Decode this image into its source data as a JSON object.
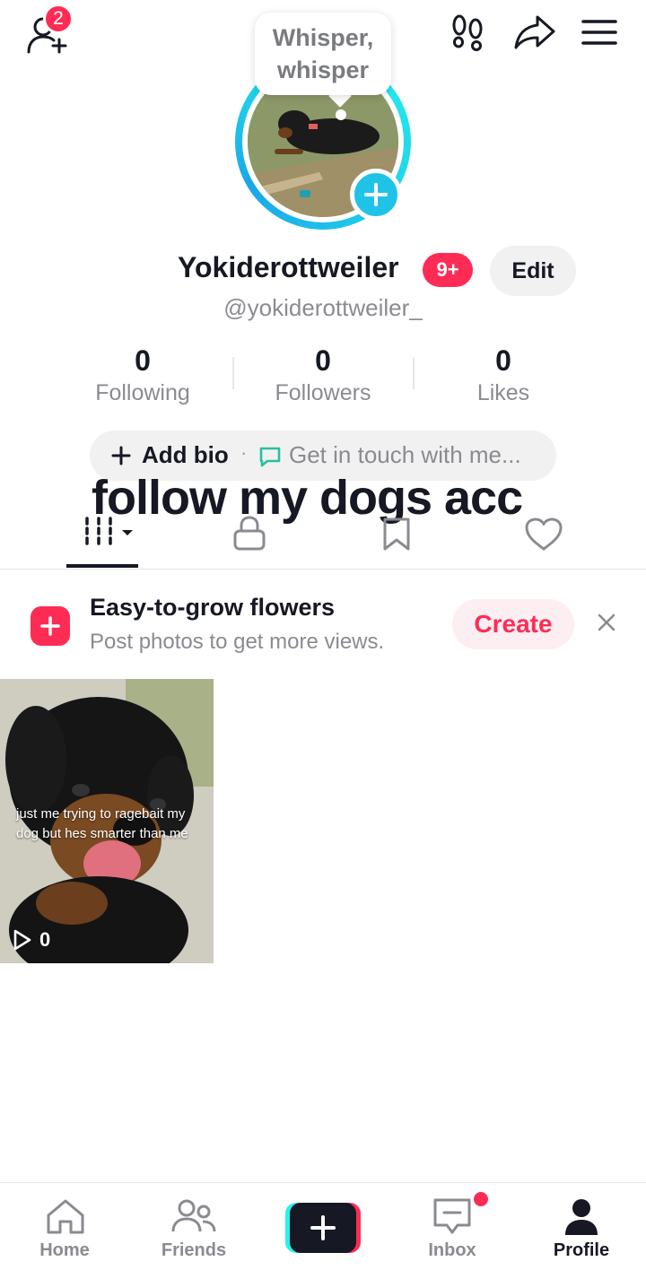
{
  "topbar": {
    "friends_badge": "2"
  },
  "avatar": {
    "bubble_line1": "Whisper,",
    "bubble_line2": "whisper"
  },
  "profile": {
    "display_name": "Yokiderottweiler",
    "name_badge": "9+",
    "edit_label": "Edit",
    "handle": "@yokiderottweiler_"
  },
  "stats": [
    {
      "value": "0",
      "label": "Following"
    },
    {
      "value": "0",
      "label": "Followers"
    },
    {
      "value": "0",
      "label": "Likes"
    }
  ],
  "bio_bar": {
    "add_bio": "Add bio",
    "separator": "·",
    "contact": "Get in touch with me..."
  },
  "overlay_text": "follow my dogs acc",
  "tabs": [
    "videos-grid",
    "private",
    "saved",
    "liked"
  ],
  "promo": {
    "title": "Easy-to-grow flowers",
    "subtitle": "Post photos to get more views.",
    "create_label": "Create"
  },
  "videos": [
    {
      "caption": "just me trying to ragebait my dog but hes smarter than me",
      "views": "0"
    }
  ],
  "bottom_nav": {
    "home": "Home",
    "friends": "Friends",
    "inbox": "Inbox",
    "profile": "Profile"
  },
  "colors": {
    "accent": "#fe2c55",
    "cyan": "#20c3e8",
    "text": "#161823",
    "muted": "#8a8b91"
  }
}
